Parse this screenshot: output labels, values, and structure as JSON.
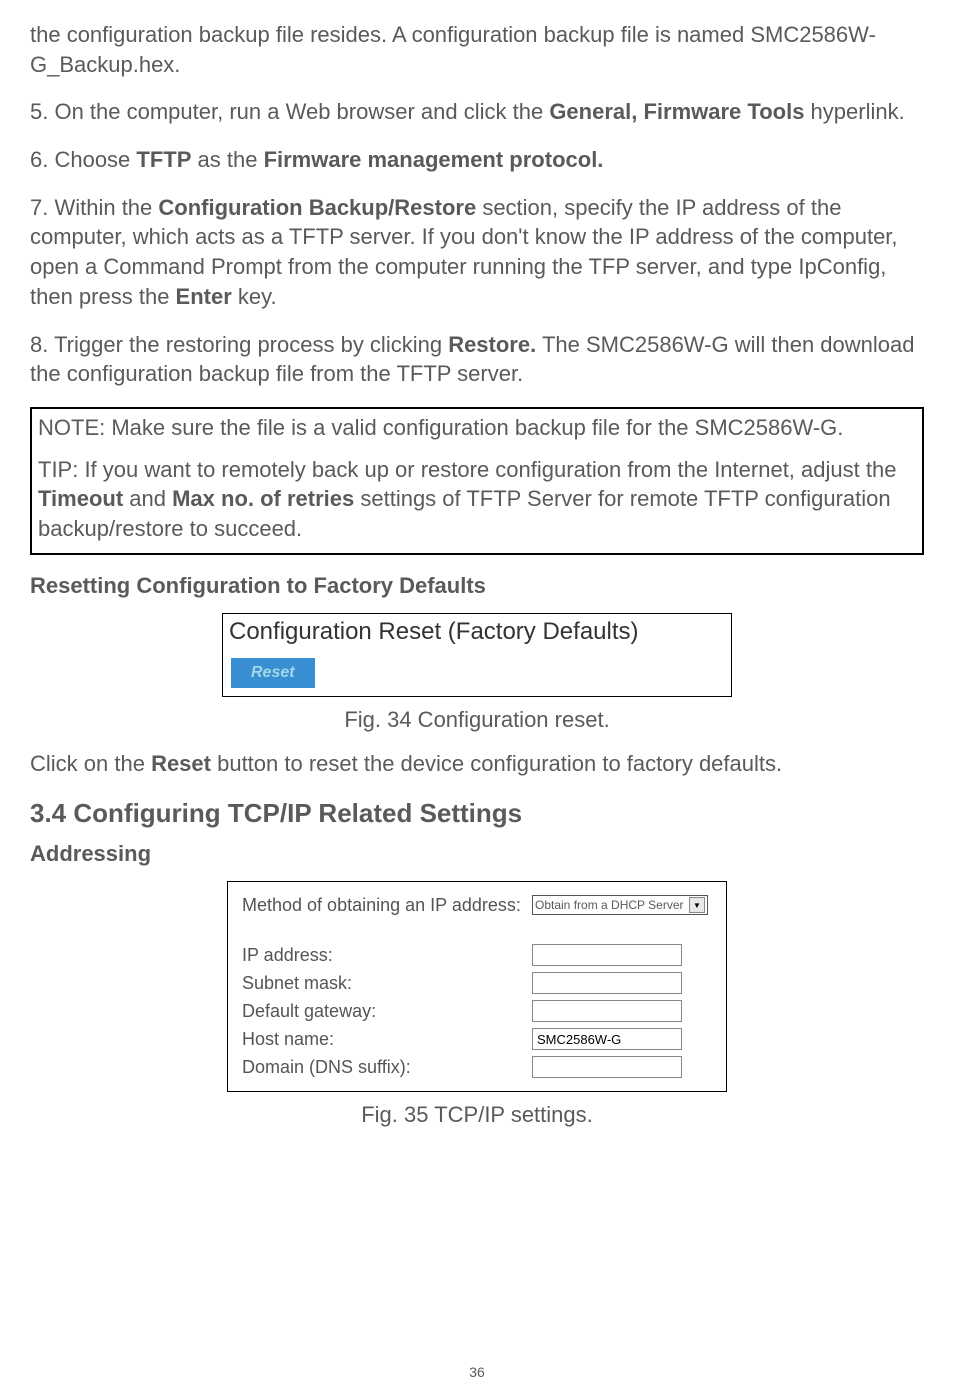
{
  "para1": "the configuration backup file resides. A configuration backup file is named SMC2586W-G_Backup.hex.",
  "para2a": "5. On the computer, run a Web browser and click the ",
  "para2b": "General, Firmware Tools",
  "para2c": " hyperlink.",
  "para3a": "6. Choose ",
  "para3b": "TFTP",
  "para3c": " as the ",
  "para3d": "Firmware management protocol.",
  "para4a": "7. Within the ",
  "para4b": "Configuration Backup/Restore",
  "para4c": " section, specify the IP address of the computer, which acts as a TFTP server. If you don't know the IP address of the computer, open a Command Prompt from the computer running the TFP server, and type IpConfig, then press the ",
  "para4d": "Enter",
  "para4e": " key.",
  "para5a": "8. Trigger the restoring process by clicking ",
  "para5b": "Restore.",
  "para5c": " The SMC2586W-G will then download the configuration backup file from the TFTP server.",
  "note": "NOTE: Make sure the file is a valid configuration backup file for the SMC2586W-G.",
  "tip_a": "TIP: If you want to remotely back up or restore configuration from the Internet, adjust the ",
  "tip_b": "Timeout",
  "tip_c": " and ",
  "tip_d": "Max no. of retries",
  "tip_e": " settings of TFTP Server for remote TFTP configuration backup/restore to succeed.",
  "subheading1": "Resetting Configuration to Factory Defaults",
  "fig34": {
    "title": "Configuration Reset (Factory Defaults)",
    "button": "Reset",
    "caption": "Fig. 34 Configuration reset."
  },
  "para6a": "Click on the ",
  "para6b": "Reset",
  "para6c": " button to reset the device configuration to factory defaults.",
  "section_heading": "3.4 Configuring TCP/IP Related Settings",
  "subheading2": "Addressing",
  "fig35": {
    "labels": {
      "method": "Method of obtaining an IP address:",
      "ip": "IP address:",
      "subnet": "Subnet mask:",
      "gateway": "Default gateway:",
      "host": "Host name:",
      "domain": "Domain (DNS suffix):"
    },
    "select_value": "Obtain from a DHCP Server",
    "host_value": "SMC2586W-G",
    "caption": "Fig. 35 TCP/IP settings."
  },
  "page_number": "36"
}
